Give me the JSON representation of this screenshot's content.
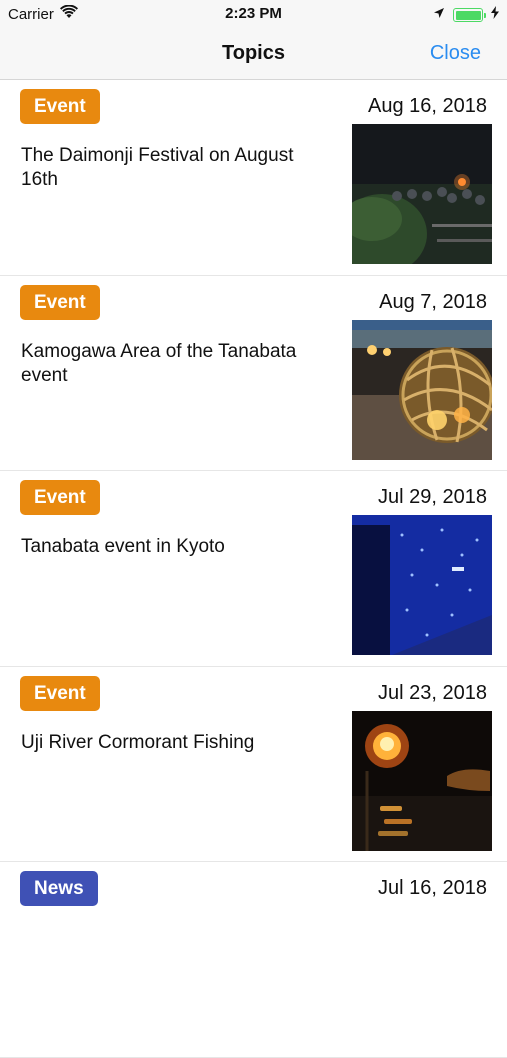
{
  "status_bar": {
    "carrier": "Carrier",
    "time": "2:23 PM",
    "icons": [
      "wifi-icon",
      "location-arrow-icon",
      "battery-icon",
      "charging-bolt-icon"
    ],
    "battery_level": 1.0
  },
  "nav": {
    "title": "Topics",
    "close_label": "Close"
  },
  "colors": {
    "event_badge": "#e8890f",
    "news_badge": "#3f51b5",
    "accent": "#2a8cf0"
  },
  "items": [
    {
      "tag": "Event",
      "date": "Aug 16, 2018",
      "title": "The Daimonji Festival on August 16th"
    },
    {
      "tag": "Event",
      "date": "Aug 7, 2018",
      "title": "Kamogawa Area of the Tanabata event"
    },
    {
      "tag": "Event",
      "date": "Jul 29, 2018",
      "title": "Tanabata event in Kyoto"
    },
    {
      "tag": "Event",
      "date": "Jul 23, 2018",
      "title": "Uji River Cormorant Fishing"
    },
    {
      "tag": "News",
      "date": "Jul 16, 2018",
      "title": ""
    }
  ]
}
